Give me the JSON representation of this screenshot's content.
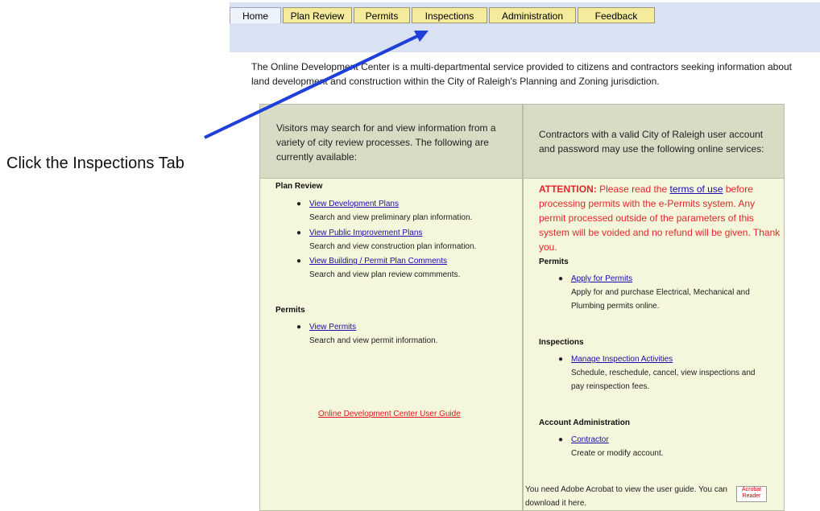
{
  "tabs": [
    {
      "label": "Home"
    },
    {
      "label": "Plan Review"
    },
    {
      "label": "Permits"
    },
    {
      "label": "Inspections"
    },
    {
      "label": "Administration"
    },
    {
      "label": "Feedback"
    }
  ],
  "intro": "The Online Development Center is a multi-departmental service provided to citizens and contractors seeking information about land development and construction within the City of Raleigh's Planning and Zoning jurisdiction.",
  "left": {
    "header": "Visitors may search for and view information from a variety of city review processes.  The following are currently available:",
    "plan_review_title": "Plan Review",
    "items": [
      {
        "link": "View Development Plans",
        "desc": "Search and view preliminary plan information."
      },
      {
        "link": "View Public Improvement Plans",
        "desc": "Search and view construction plan information."
      },
      {
        "link": "View Building / Permit Plan Comments",
        "desc": "Search and view plan review commments."
      }
    ],
    "permits_title": "Permits",
    "permit_item": {
      "link": "View Permits",
      "desc": "Search and view permit information."
    },
    "guide": "Online Development Center User Guide"
  },
  "right": {
    "header": "Contractors with a valid City of Raleigh user account and password may use the following online services:",
    "attention_label": "ATTENTION:",
    "attention_pre": " Please read the ",
    "terms_link": "terms of use",
    "attention_post": " before processing permits with the e-Permits system. Any permit processed outside of the parameters of this system will be voided and no refund will be given. Thank you.",
    "permits_title": "Permits",
    "apply": {
      "link": "Apply for Permits",
      "desc": "Apply for and purchase Electrical, Mechanical and Plumbing permits online."
    },
    "inspections_title": "Inspections",
    "inspections": {
      "link": "Manage Inspection Activities",
      "desc": "Schedule, reschedule, cancel, view inspections and pay reinspection fees."
    },
    "account_title": "Account Administration",
    "account": {
      "link": "Contractor",
      "desc": "Create or modify account."
    },
    "acrobat_note": "You need Adobe Acrobat to view the user guide. You can download it here.",
    "acrobat_badge": "Acrobat Reader"
  },
  "annotation": "Click the Inspections Tab",
  "colors": {
    "arrow": "#1f3fd8",
    "tab_yellow": "#f4ec9c",
    "panel_bg": "#f4f7dc",
    "attention": "#e3262b"
  }
}
